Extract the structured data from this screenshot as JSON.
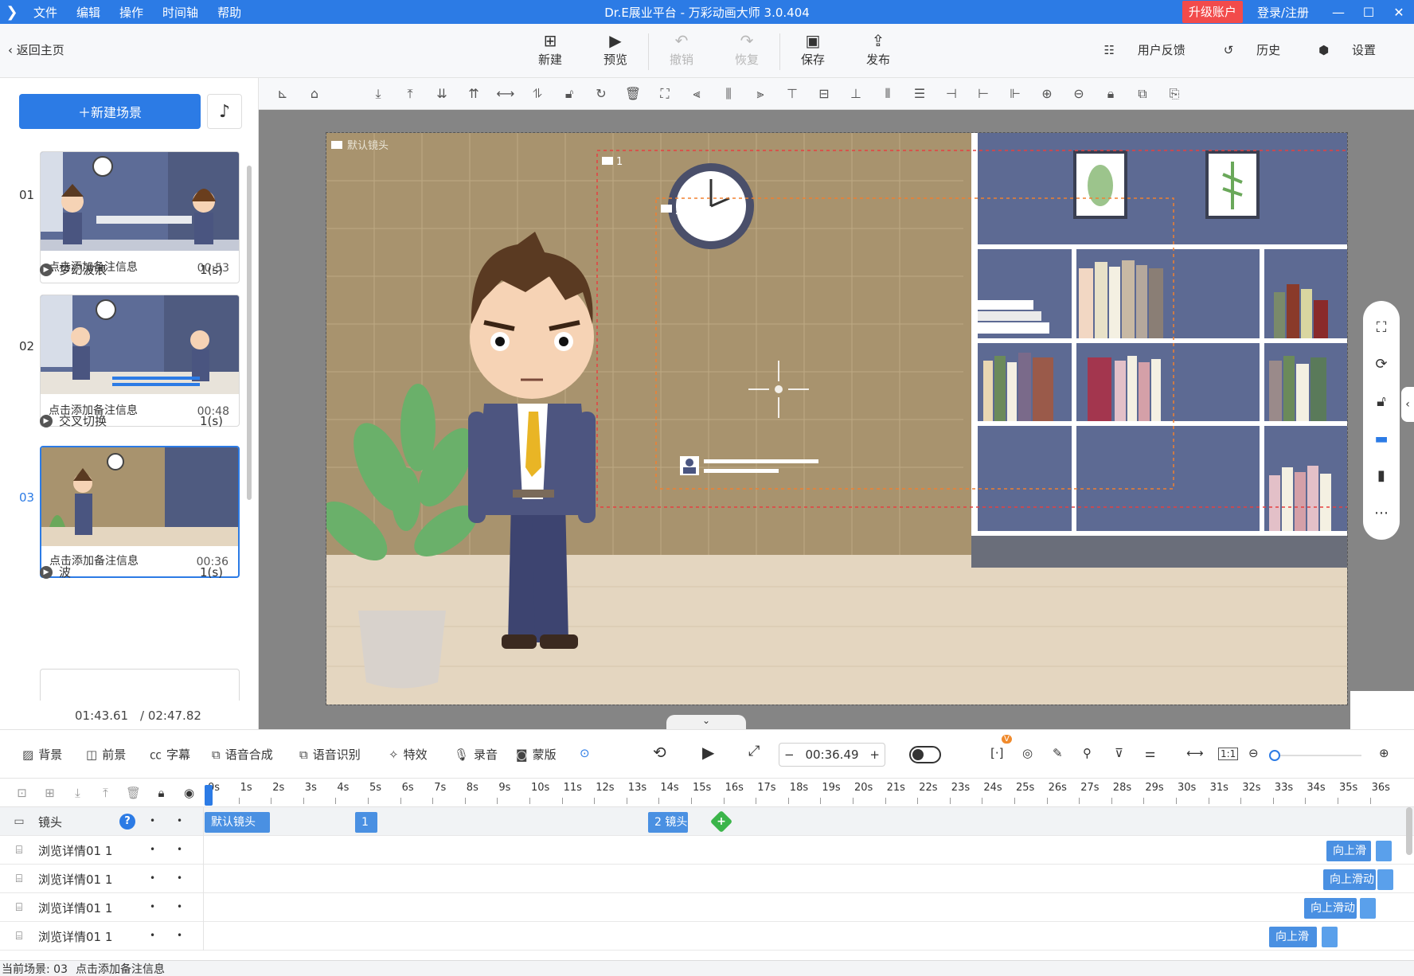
{
  "titlebar": {
    "app_title": "Dr.E展业平台 - 万彩动画大师 3.0.404",
    "menus": [
      "文件",
      "编辑",
      "操作",
      "时间轴",
      "帮助"
    ],
    "upgrade": "升级账户",
    "login": "登录/注册",
    "minimize": "—",
    "maximize": "☐",
    "close": "✕"
  },
  "toolbar": {
    "back": "返回主页",
    "buttons": [
      {
        "label": "新建",
        "icon": "plus-square-icon"
      },
      {
        "label": "预览",
        "icon": "play-icon"
      },
      {
        "label": "撤销",
        "icon": "undo-icon"
      },
      {
        "label": "恢复",
        "icon": "redo-icon"
      },
      {
        "label": "保存",
        "icon": "save-icon"
      },
      {
        "label": "发布",
        "icon": "publish-icon"
      }
    ],
    "feedback": "用户反馈",
    "history": "历史",
    "settings": "设置"
  },
  "left": {
    "new_scene": "新建场景",
    "scenes": [
      {
        "num": "01",
        "note": "点击添加备注信息",
        "duration": "00:53",
        "transition": "梦幻波浪",
        "trans_len": "1(s)"
      },
      {
        "num": "02",
        "note": "点击添加备注信息",
        "duration": "00:48",
        "transition": "交叉切换",
        "trans_len": "1(s)"
      },
      {
        "num": "03",
        "note": "点击添加备注信息",
        "duration": "00:36",
        "transition": "波",
        "trans_len": "1(s)"
      }
    ],
    "current_time": "01:43.61",
    "total_time": "/ 02:47.82"
  },
  "canvas": {
    "default_camera_label": "默认镜头",
    "cam1_label": "1",
    "cam2_label": "2"
  },
  "layerbar": {
    "items": [
      "背景",
      "前景",
      "字幕",
      "语音合成",
      "语音识别",
      "特效",
      "录音",
      "蒙版"
    ],
    "timecode": "00:36.49",
    "minus": "−",
    "plus": "+",
    "vip_badge": "V",
    "one_to_one": "1:1"
  },
  "timeline": {
    "ticks": [
      "0s",
      "1s",
      "2s",
      "3s",
      "4s",
      "5s",
      "6s",
      "7s",
      "8s",
      "9s",
      "10s",
      "11s",
      "12s",
      "13s",
      "14s",
      "15s",
      "16s",
      "17s",
      "18s",
      "19s",
      "20s",
      "21s",
      "22s",
      "23s",
      "24s",
      "25s",
      "26s",
      "27s",
      "28s",
      "29s",
      "30s",
      "31s",
      "32s",
      "33s",
      "34s",
      "35s",
      "36s"
    ],
    "camera_track": {
      "label": "镜头",
      "help": "?",
      "clips": [
        "默认镜头",
        "1",
        "2 镜头"
      ]
    },
    "tracks": [
      {
        "label": "浏览详情01 1",
        "clip": "向上滑"
      },
      {
        "label": "浏览详情01 1",
        "clip": "向上滑动"
      },
      {
        "label": "浏览详情01 1",
        "clip": "向上滑动"
      },
      {
        "label": "浏览详情01 1",
        "clip": "向上滑"
      }
    ]
  },
  "status": {
    "current_scene": "当前场景: 03",
    "note": "点击添加备注信息"
  }
}
